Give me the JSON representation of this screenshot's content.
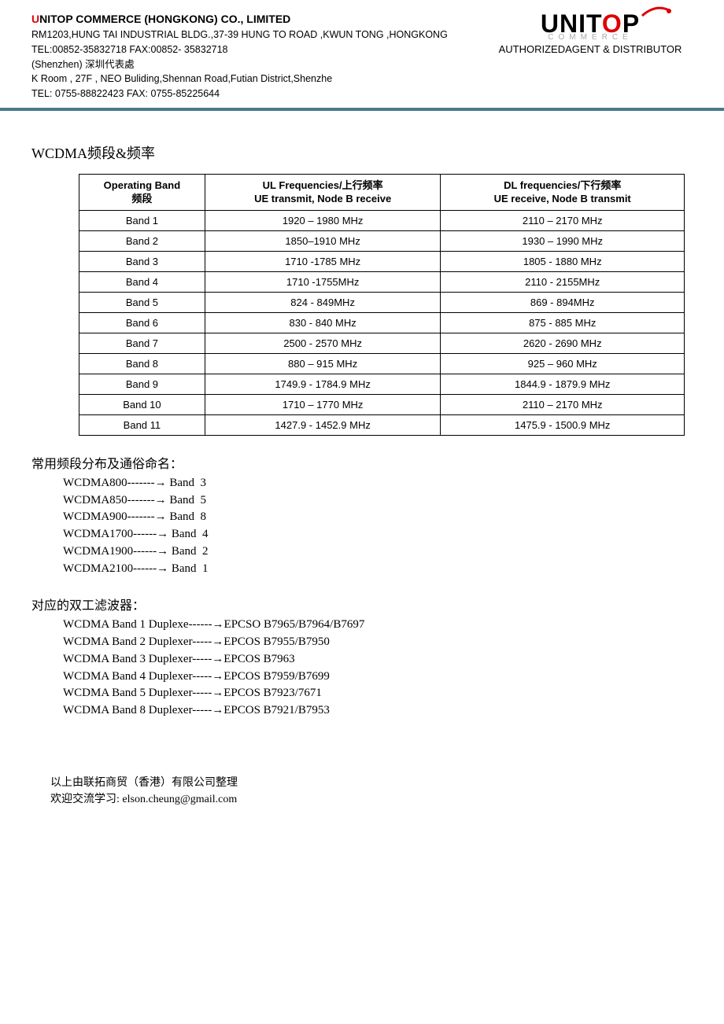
{
  "header": {
    "company_name": "NITOP COMMERCE (HONGKONG) CO., LIMITED",
    "company_u": "U",
    "line1": "RM1203,HUNG TAI INDUSTRIAL BLDG.,37-39 HUNG TO ROAD ,KWUN TONG  ,HONGKONG",
    "line2": "TEL:00852-35832718    FAX:00852- 35832718",
    "line3": "(Shenzhen) 深圳代表處",
    "line4": "K Room , 27F , NEO Buliding,Shennan Road,Futian District,Shenzhe",
    "line5": "TEL: 0755-88822423 FAX: 0755-85225644",
    "logo_text1": "UNIT",
    "logo_text_o": "O",
    "logo_text2": "P",
    "logo_sub": "COMMERCE",
    "tagline": "AUTHORIZEDAGENT & DISTRIBUTOR"
  },
  "title": "WCDMA频段&频率",
  "table": {
    "headers": {
      "col1_l1": "Operating Band",
      "col1_l2": "频段",
      "col2_l1": "UL Frequencies/上行频率",
      "col2_l2": "UE transmit, Node B receive",
      "col3_l1": "DL frequencies/下行频率",
      "col3_l2": "UE receive, Node B transmit"
    },
    "rows": [
      {
        "band": "Band  1",
        "ul": "1920 – 1980 MHz",
        "dl": "2110 – 2170 MHz"
      },
      {
        "band": "Band  2",
        "ul": "1850–1910 MHz",
        "dl": "1930 – 1990 MHz"
      },
      {
        "band": "Band  3",
        "ul": "1710 -1785 MHz",
        "dl": "1805 - 1880 MHz"
      },
      {
        "band": "Band 4",
        "ul": "1710 -1755MHz",
        "dl": "2110 - 2155MHz"
      },
      {
        "band": "Band  5",
        "ul": "824 - 849MHz",
        "dl": "869 - 894MHz"
      },
      {
        "band": "Band  6",
        "ul": "830 - 840 MHz",
        "dl": "875 - 885 MHz"
      },
      {
        "band": "Band  7",
        "ul": "2500 - 2570 MHz",
        "dl": "2620 - 2690 MHz"
      },
      {
        "band": "Band  8",
        "ul": "880 – 915 MHz",
        "dl": "925 – 960 MHz"
      },
      {
        "band": "Band  9",
        "ul": "1749.9 - 1784.9 MHz",
        "dl": "1844.9 - 1879.9 MHz"
      },
      {
        "band": "Band  10",
        "ul": "1710 – 1770 MHz",
        "dl": "2110 – 2170 MHz"
      },
      {
        "band": "Band  11",
        "ul": "1427.9 - 1452.9 MHz",
        "dl": "1475.9 - 1500.9 MHz"
      }
    ]
  },
  "section2_title": "常用频段分布及通俗命名：",
  "naming": [
    "WCDMA800-------→ Band  3",
    "WCDMA850-------→ Band  5",
    "WCDMA900-------→ Band  8",
    "WCDMA1700------→ Band  4",
    "WCDMA1900------→ Band  2",
    "WCDMA2100------→ Band  1"
  ],
  "section3_title": "对应的双工滤波器：",
  "duplexers": [
    "WCDMA Band 1 Duplexe------→EPCSO B7965/B7964/B7697",
    "WCDMA Band 2 Duplexer-----→EPCOS B7955/B7950",
    "WCDMA Band 3 Duplexer-----→EPCOS B7963",
    "WCDMA Band 4 Duplexer-----→EPCOS B7959/B7699",
    "WCDMA Band 5 Duplexer-----→EPCOS B7923/7671",
    "WCDMA Band 8 Duplexer-----→EPCOS B7921/B7953"
  ],
  "footer": {
    "line1": "以上由联拓商贸（香港）有限公司整理",
    "line2": "欢迎交流学习: elson.cheung@gmail.com"
  }
}
